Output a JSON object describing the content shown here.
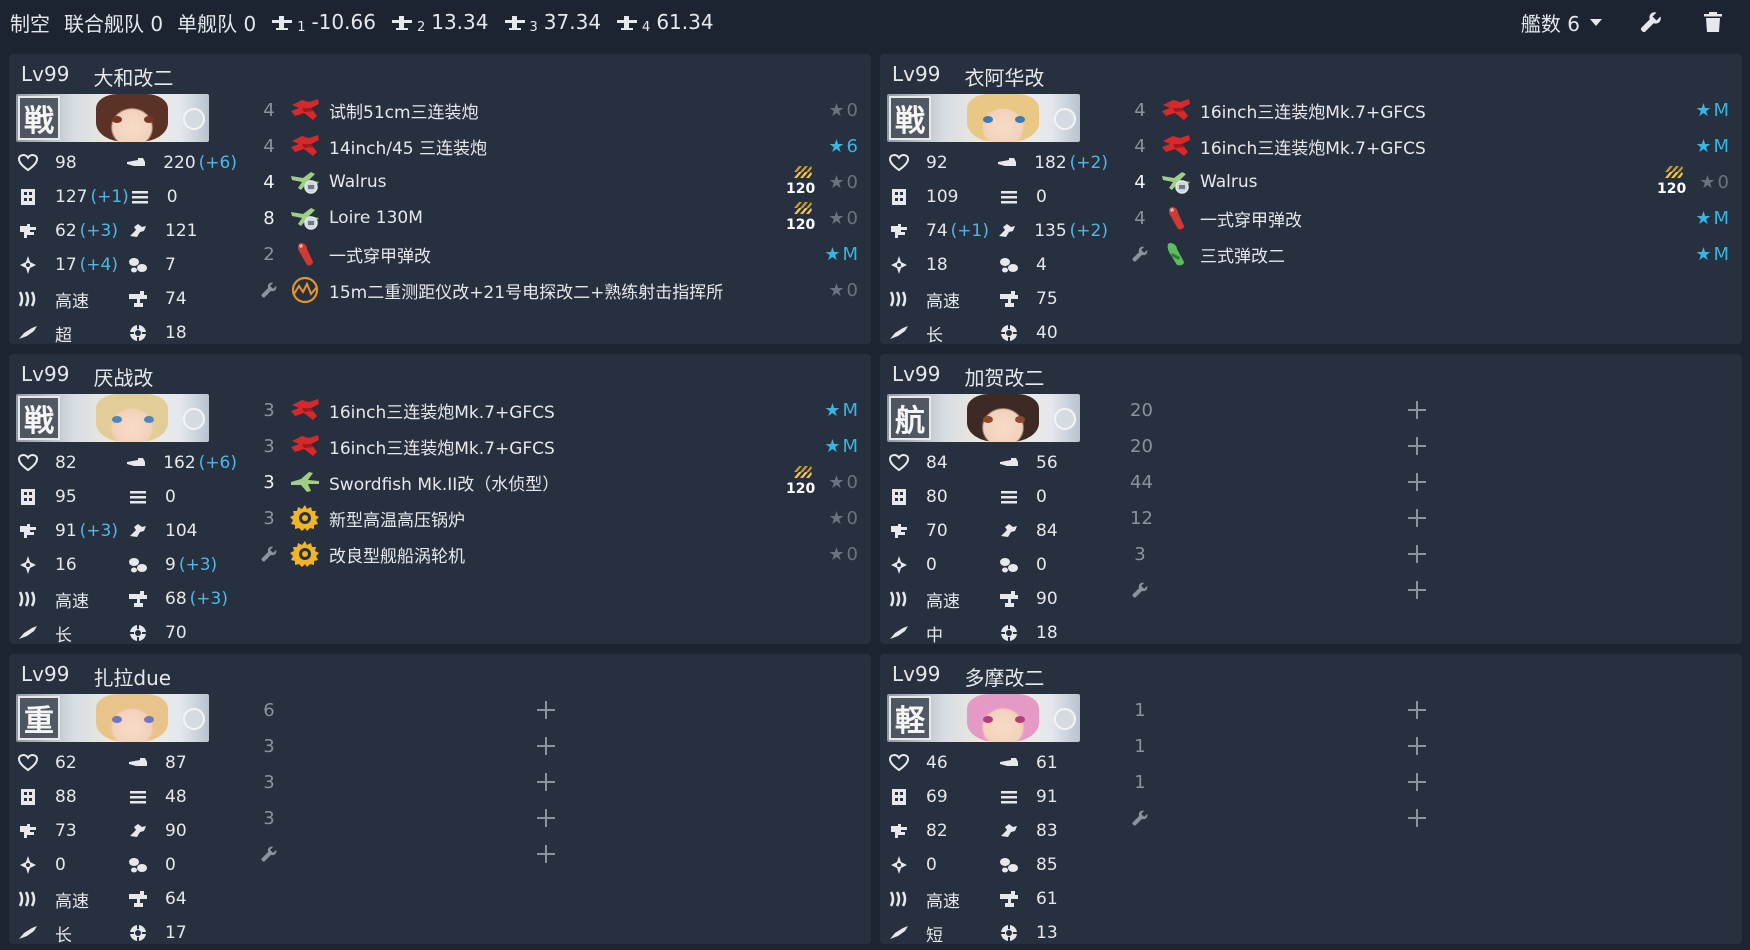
{
  "header": {
    "air_label": "制空",
    "combined_label": "联合舰队",
    "combined_value": "0",
    "single_label": "单舰队",
    "single_value": "0",
    "fights": [
      {
        "sub": "1",
        "value": "-10.66"
      },
      {
        "sub": "2",
        "value": "13.34"
      },
      {
        "sub": "3",
        "value": "37.34"
      },
      {
        "sub": "4",
        "value": "61.34"
      }
    ],
    "ship_count": "艦数 6"
  },
  "ships": [
    {
      "level": "Lv99",
      "name": "大和改二",
      "type": "戦",
      "hair": "#5a3326",
      "eye": "#7a3420",
      "stats": [
        [
          "98",
          "",
          "220",
          "(+6)"
        ],
        [
          "127",
          "(+1)",
          "0",
          ""
        ],
        [
          "62",
          "(+3)",
          "121",
          ""
        ],
        [
          "17",
          "(+4)",
          "7",
          ""
        ],
        [
          "高速",
          "",
          "74",
          ""
        ],
        [
          "超",
          "",
          "18",
          ""
        ]
      ],
      "equips": [
        {
          "slot": "4",
          "icon": "gun-red",
          "name": "试制51cm三连装炮",
          "prof": "",
          "star": "0",
          "star_on": false
        },
        {
          "slot": "4",
          "icon": "gun-red",
          "name": "14inch/45 三连装炮",
          "prof": "",
          "star": "6",
          "star_on": true
        },
        {
          "slot": "4",
          "icon": "seaplane",
          "name": "Walrus",
          "prof": "120",
          "star": "0",
          "star_on": false
        },
        {
          "slot": "8",
          "icon": "seaplane",
          "name": "Loire 130M",
          "prof": "120",
          "star": "0",
          "star_on": false
        },
        {
          "slot": "2",
          "icon": "shell",
          "name": "一式穿甲弹改",
          "prof": "",
          "star": "M",
          "star_on": true
        },
        {
          "slot": "wrench",
          "icon": "radar",
          "name": "15m二重测距仪改+21号电探改二+熟练射击指挥所",
          "prof": "",
          "star": "0",
          "star_on": false
        }
      ],
      "empty_slots": []
    },
    {
      "level": "Lv99",
      "name": "衣阿华改",
      "type": "戦",
      "hair": "#e8c884",
      "eye": "#3f7ab8",
      "stats": [
        [
          "92",
          "",
          "182",
          "(+2)"
        ],
        [
          "109",
          "",
          "0",
          ""
        ],
        [
          "74",
          "(+1)",
          "135",
          "(+2)"
        ],
        [
          "18",
          "",
          "4",
          ""
        ],
        [
          "高速",
          "",
          "75",
          ""
        ],
        [
          "长",
          "",
          "40",
          ""
        ]
      ],
      "equips": [
        {
          "slot": "4",
          "icon": "gun-red",
          "name": "16inch三连装炮Mk.7+GFCS",
          "prof": "",
          "star": "M",
          "star_on": true
        },
        {
          "slot": "4",
          "icon": "gun-red",
          "name": "16inch三连装炮Mk.7+GFCS",
          "prof": "",
          "star": "M",
          "star_on": true
        },
        {
          "slot": "4",
          "icon": "seaplane",
          "name": "Walrus",
          "prof": "120",
          "star": "0",
          "star_on": false
        },
        {
          "slot": "4",
          "icon": "shell",
          "name": "一式穿甲弹改",
          "prof": "",
          "star": "M",
          "star_on": true
        },
        {
          "slot": "wrench",
          "icon": "shell-green",
          "name": "三式弹改二",
          "prof": "",
          "star": "M",
          "star_on": true
        }
      ],
      "empty_slots": []
    },
    {
      "level": "Lv99",
      "name": "厌战改",
      "type": "戦",
      "hair": "#e2cc98",
      "eye": "#4f86be",
      "stats": [
        [
          "82",
          "",
          "162",
          "(+6)"
        ],
        [
          "95",
          "",
          "0",
          ""
        ],
        [
          "91",
          "(+3)",
          "104",
          ""
        ],
        [
          "16",
          "",
          "9",
          "(+3)"
        ],
        [
          "高速",
          "",
          "68",
          "(+3)"
        ],
        [
          "长",
          "",
          "70",
          ""
        ]
      ],
      "equips": [
        {
          "slot": "3",
          "icon": "gun-red",
          "name": "16inch三连装炮Mk.7+GFCS",
          "prof": "",
          "star": "M",
          "star_on": true
        },
        {
          "slot": "3",
          "icon": "gun-red",
          "name": "16inch三连装炮Mk.7+GFCS",
          "prof": "",
          "star": "M",
          "star_on": true
        },
        {
          "slot": "3",
          "icon": "seaplane-green",
          "name": "Swordfish Mk.II改（水侦型）",
          "prof": "120",
          "star": "0",
          "star_on": false
        },
        {
          "slot": "3",
          "icon": "boiler",
          "name": "新型高温高压锅炉",
          "prof": "",
          "star": "0",
          "star_on": false
        },
        {
          "slot": "wrench",
          "icon": "boiler",
          "name": "改良型舰船涡轮机",
          "prof": "",
          "star": "0",
          "star_on": false
        }
      ],
      "empty_slots": []
    },
    {
      "level": "Lv99",
      "name": "加贺改二",
      "type": "航",
      "hair": "#3d2a24",
      "eye": "#8a4b2a",
      "stats": [
        [
          "84",
          "",
          "56",
          ""
        ],
        [
          "80",
          "",
          "0",
          ""
        ],
        [
          "70",
          "",
          "84",
          ""
        ],
        [
          "0",
          "",
          "0",
          ""
        ],
        [
          "高速",
          "",
          "90",
          ""
        ],
        [
          "中",
          "",
          "18",
          ""
        ]
      ],
      "equips": [],
      "empty_slots": [
        "20",
        "20",
        "44",
        "12",
        "3",
        "wrench"
      ]
    },
    {
      "level": "Lv99",
      "name": "扎拉due",
      "type": "重",
      "hair": "#e8c38a",
      "eye": "#6e78c0",
      "stats": [
        [
          "62",
          "",
          "87",
          ""
        ],
        [
          "88",
          "",
          "48",
          ""
        ],
        [
          "73",
          "",
          "90",
          ""
        ],
        [
          "0",
          "",
          "0",
          ""
        ],
        [
          "高速",
          "",
          "64",
          ""
        ],
        [
          "长",
          "",
          "17",
          ""
        ]
      ],
      "equips": [],
      "empty_slots": [
        "6",
        "3",
        "3",
        "3",
        "wrench"
      ]
    },
    {
      "level": "Lv99",
      "name": "多摩改二",
      "type": "軽",
      "hair": "#e59ac6",
      "eye": "#b33f7a",
      "stats": [
        [
          "46",
          "",
          "61",
          ""
        ],
        [
          "69",
          "",
          "91",
          ""
        ],
        [
          "82",
          "",
          "83",
          ""
        ],
        [
          "0",
          "",
          "85",
          ""
        ],
        [
          "高速",
          "",
          "61",
          ""
        ],
        [
          "短",
          "",
          "13",
          ""
        ]
      ],
      "equips": [],
      "empty_slots": [
        "1",
        "1",
        "1",
        "wrench"
      ]
    }
  ],
  "stat_icons": [
    [
      "hp-icon",
      "firepower-icon"
    ],
    [
      "armor-icon",
      "torpedo-icon"
    ],
    [
      "evasion-icon",
      "anti-air-icon"
    ],
    [
      "asw-icon",
      "luck-icon"
    ],
    [
      "speed-icon",
      "los-icon"
    ],
    [
      "range-icon",
      "accuracy-icon"
    ]
  ],
  "colors": {
    "star_on": "#3ab4e0",
    "star_off": "#6a7380",
    "bonus": "#4fb8e8",
    "panel": "#27303e",
    "background": "#1c2331"
  }
}
